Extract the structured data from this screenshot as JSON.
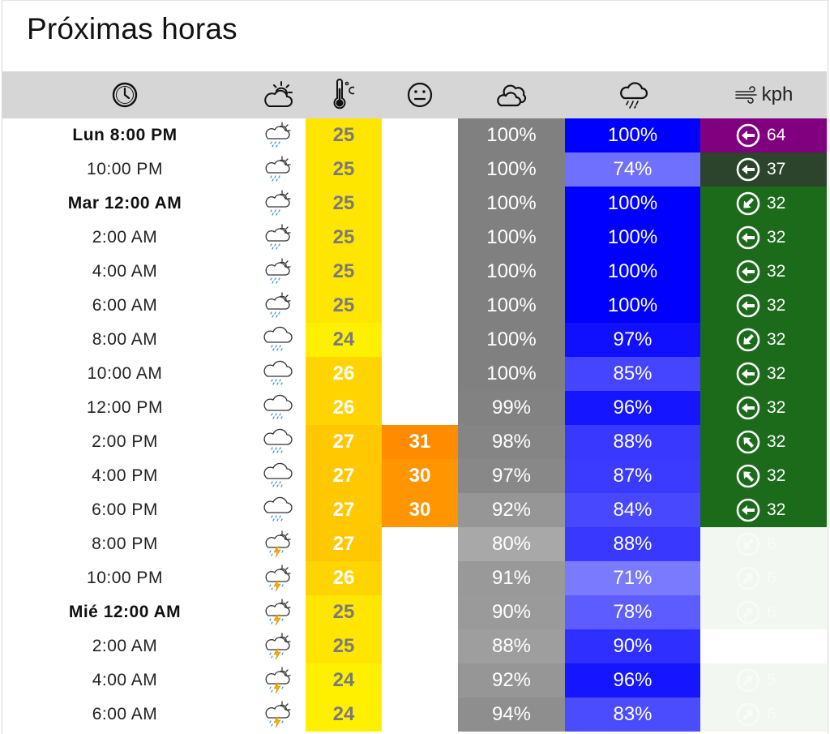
{
  "title": "Próximas horas",
  "header": {
    "wind_unit": "kph"
  },
  "rows": [
    {
      "time": "Lun 8:00 PM",
      "bold": true,
      "icon": "cloud-rain-sun-icon",
      "temp": "25",
      "temp_color": "#ffe600",
      "temp_text": "#7a7a7a",
      "feel": "",
      "feel_color": "",
      "cloud": "100%",
      "cloud_color": "#808080",
      "rain": "100%",
      "rain_color": "#0000ff",
      "wind_dir": "W",
      "wind": "64",
      "wind_color": "#800080",
      "wind_opacity": 1
    },
    {
      "time": "10:00 PM",
      "bold": false,
      "icon": "cloud-rain-sun-icon",
      "temp": "25",
      "temp_color": "#ffe600",
      "temp_text": "#7a7a7a",
      "feel": "",
      "feel_color": "",
      "cloud": "100%",
      "cloud_color": "#808080",
      "rain": "74%",
      "rain_color": "#7070ff",
      "wind_dir": "W",
      "wind": "37",
      "wind_color": "#2b442b",
      "wind_opacity": 1
    },
    {
      "time": "Mar 12:00 AM",
      "bold": true,
      "icon": "cloud-rain-sun-icon",
      "temp": "25",
      "temp_color": "#ffe600",
      "temp_text": "#7a7a7a",
      "feel": "",
      "feel_color": "",
      "cloud": "100%",
      "cloud_color": "#808080",
      "rain": "100%",
      "rain_color": "#0000ff",
      "wind_dir": "SW",
      "wind": "32",
      "wind_color": "#1b6b1b",
      "wind_opacity": 1
    },
    {
      "time": "2:00 AM",
      "bold": false,
      "icon": "cloud-rain-sun-icon",
      "temp": "25",
      "temp_color": "#ffe600",
      "temp_text": "#7a7a7a",
      "feel": "",
      "feel_color": "",
      "cloud": "100%",
      "cloud_color": "#808080",
      "rain": "100%",
      "rain_color": "#0000ff",
      "wind_dir": "W",
      "wind": "32",
      "wind_color": "#1b6b1b",
      "wind_opacity": 1
    },
    {
      "time": "4:00 AM",
      "bold": false,
      "icon": "cloud-rain-sun-icon",
      "temp": "25",
      "temp_color": "#ffe600",
      "temp_text": "#7a7a7a",
      "feel": "",
      "feel_color": "",
      "cloud": "100%",
      "cloud_color": "#808080",
      "rain": "100%",
      "rain_color": "#0000ff",
      "wind_dir": "W",
      "wind": "32",
      "wind_color": "#1b6b1b",
      "wind_opacity": 1
    },
    {
      "time": "6:00 AM",
      "bold": false,
      "icon": "cloud-rain-sun-icon",
      "temp": "25",
      "temp_color": "#ffe600",
      "temp_text": "#7a7a7a",
      "feel": "",
      "feel_color": "",
      "cloud": "100%",
      "cloud_color": "#808080",
      "rain": "100%",
      "rain_color": "#0000ff",
      "wind_dir": "W",
      "wind": "32",
      "wind_color": "#1b6b1b",
      "wind_opacity": 1
    },
    {
      "time": "8:00 AM",
      "bold": false,
      "icon": "cloud-rain-icon",
      "temp": "24",
      "temp_color": "#fff000",
      "temp_text": "#7a7a7a",
      "feel": "",
      "feel_color": "",
      "cloud": "100%",
      "cloud_color": "#808080",
      "rain": "97%",
      "rain_color": "#1010ff",
      "wind_dir": "SW",
      "wind": "32",
      "wind_color": "#1b6b1b",
      "wind_opacity": 1
    },
    {
      "time": "10:00 AM",
      "bold": false,
      "icon": "cloud-rain-icon",
      "temp": "26",
      "temp_color": "#ffd400",
      "temp_text": "#ffffff",
      "feel": "",
      "feel_color": "",
      "cloud": "100%",
      "cloud_color": "#808080",
      "rain": "85%",
      "rain_color": "#4545ff",
      "wind_dir": "W",
      "wind": "32",
      "wind_color": "#1b6b1b",
      "wind_opacity": 1
    },
    {
      "time": "12:00 PM",
      "bold": false,
      "icon": "cloud-rain-icon",
      "temp": "26",
      "temp_color": "#ffd400",
      "temp_text": "#ffffff",
      "feel": "",
      "feel_color": "",
      "cloud": "99%",
      "cloud_color": "#828282",
      "rain": "96%",
      "rain_color": "#1515ff",
      "wind_dir": "W",
      "wind": "32",
      "wind_color": "#1b6b1b",
      "wind_opacity": 1
    },
    {
      "time": "2:00 PM",
      "bold": false,
      "icon": "cloud-rain-icon",
      "temp": "27",
      "temp_color": "#ffc800",
      "temp_text": "#ffffff",
      "feel": "31",
      "feel_color": "#ff8c00",
      "cloud": "98%",
      "cloud_color": "#858585",
      "rain": "88%",
      "rain_color": "#3838ff",
      "wind_dir": "NW",
      "wind": "32",
      "wind_color": "#1b6b1b",
      "wind_opacity": 1
    },
    {
      "time": "4:00 PM",
      "bold": false,
      "icon": "cloud-rain-icon",
      "temp": "27",
      "temp_color": "#ffc800",
      "temp_text": "#ffffff",
      "feel": "30",
      "feel_color": "#ff9500",
      "cloud": "97%",
      "cloud_color": "#888888",
      "rain": "87%",
      "rain_color": "#3b3bff",
      "wind_dir": "NW",
      "wind": "32",
      "wind_color": "#1b6b1b",
      "wind_opacity": 1
    },
    {
      "time": "6:00 PM",
      "bold": false,
      "icon": "cloud-rain-icon",
      "temp": "27",
      "temp_color": "#ffc800",
      "temp_text": "#ffffff",
      "feel": "30",
      "feel_color": "#ff9500",
      "cloud": "92%",
      "cloud_color": "#969696",
      "rain": "84%",
      "rain_color": "#4848ff",
      "wind_dir": "W",
      "wind": "32",
      "wind_color": "#1b6b1b",
      "wind_opacity": 1
    },
    {
      "time": "8:00 PM",
      "bold": false,
      "icon": "cloud-storm-sun-icon",
      "temp": "27",
      "temp_color": "#ffc800",
      "temp_text": "#ffffff",
      "feel": "",
      "feel_color": "",
      "cloud": "80%",
      "cloud_color": "#a8a8a8",
      "rain": "88%",
      "rain_color": "#3838ff",
      "wind_dir": "SW",
      "wind": "6",
      "wind_color": "#f2f7f2",
      "wind_opacity": 0.35
    },
    {
      "time": "10:00 PM",
      "bold": false,
      "icon": "cloud-storm-sun-icon",
      "temp": "26",
      "temp_color": "#ffd400",
      "temp_text": "#ffffff",
      "feel": "",
      "feel_color": "",
      "cloud": "91%",
      "cloud_color": "#999999",
      "rain": "71%",
      "rain_color": "#7a7aff",
      "wind_dir": "NE",
      "wind": "6",
      "wind_color": "#f2f7f2",
      "wind_opacity": 0.35
    },
    {
      "time": "Mié 12:00 AM",
      "bold": true,
      "icon": "cloud-storm-sun-icon",
      "temp": "25",
      "temp_color": "#ffe600",
      "temp_text": "#7a7a7a",
      "feel": "",
      "feel_color": "",
      "cloud": "90%",
      "cloud_color": "#9a9a9a",
      "rain": "78%",
      "rain_color": "#5c5cff",
      "wind_dir": "NE",
      "wind": "6",
      "wind_color": "#f2f7f2",
      "wind_opacity": 0.35
    },
    {
      "time": "2:00 AM",
      "bold": false,
      "icon": "cloud-storm-sun-icon",
      "temp": "25",
      "temp_color": "#ffe600",
      "temp_text": "#7a7a7a",
      "feel": "",
      "feel_color": "",
      "cloud": "88%",
      "cloud_color": "#9e9e9e",
      "rain": "90%",
      "rain_color": "#2f2fff",
      "wind_dir": "",
      "wind": "",
      "wind_color": "#ffffff",
      "wind_opacity": 0
    },
    {
      "time": "4:00 AM",
      "bold": false,
      "icon": "cloud-storm-sun-icon",
      "temp": "24",
      "temp_color": "#fff000",
      "temp_text": "#7a7a7a",
      "feel": "",
      "feel_color": "",
      "cloud": "92%",
      "cloud_color": "#969696",
      "rain": "96%",
      "rain_color": "#1515ff",
      "wind_dir": "NE",
      "wind": "5",
      "wind_color": "#f2f7f2",
      "wind_opacity": 0.35
    },
    {
      "time": "6:00 AM",
      "bold": false,
      "icon": "cloud-storm-sun-icon",
      "temp": "24",
      "temp_color": "#fff000",
      "temp_text": "#7a7a7a",
      "feel": "",
      "feel_color": "",
      "cloud": "94%",
      "cloud_color": "#8e8e8e",
      "rain": "83%",
      "rain_color": "#4c4cff",
      "wind_dir": "NE",
      "wind": "6",
      "wind_color": "#f2f7f2",
      "wind_opacity": 0.35
    }
  ]
}
